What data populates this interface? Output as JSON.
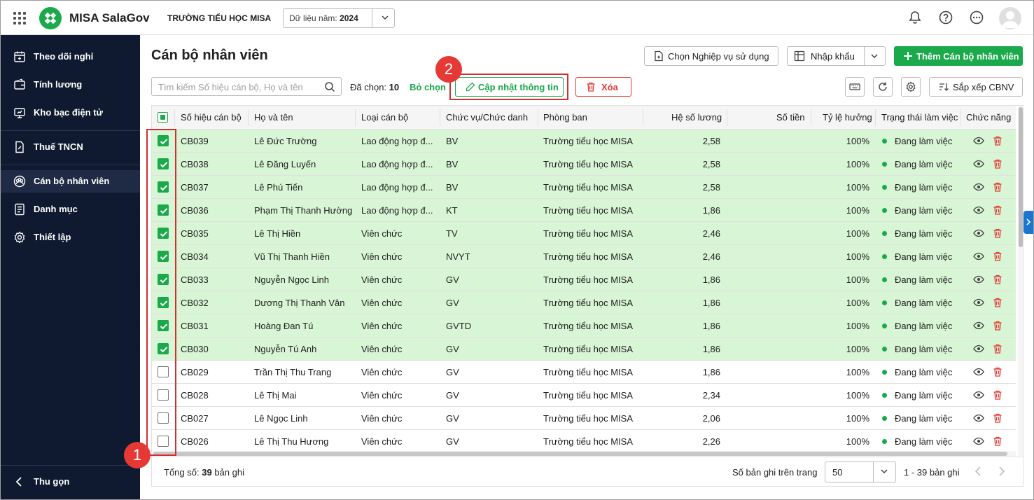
{
  "header": {
    "app_name": "MISA SalaGov",
    "school": "TRƯỜNG TIỂU HỌC MISA",
    "year_label": "Dữ liệu năm:",
    "year_value": "2024"
  },
  "sidebar": {
    "items": [
      {
        "label": "Theo dõi nghỉ",
        "icon": "calendar-icon"
      },
      {
        "label": "Tính lương",
        "icon": "wallet-icon"
      },
      {
        "label": "Kho bạc điện tử",
        "icon": "treasury-icon"
      },
      {
        "label": "Thuế TNCN",
        "icon": "tax-icon"
      },
      {
        "label": "Cán bộ nhân viên",
        "icon": "staff-icon"
      },
      {
        "label": "Danh mục",
        "icon": "catalog-icon"
      },
      {
        "label": "Thiết lập",
        "icon": "gear-icon"
      }
    ],
    "collapse_label": "Thu gọn"
  },
  "page": {
    "title": "Cán bộ nhân viên",
    "choose_service_label": "Chọn Nghiệp vụ sử dụng",
    "import_label": "Nhập khẩu",
    "add_label": "Thêm Cán bộ nhân viên",
    "search_placeholder": "Tìm kiếm Số hiệu cán bộ, Họ và tên",
    "selected_label": "Đã chọn:",
    "selected_count": "10",
    "deselect_label": "Bỏ chọn",
    "update_label": "Cập nhật thông tin",
    "delete_label": "Xóa",
    "sort_label": "Sắp xếp CBNV"
  },
  "annotations": {
    "badge1": "1",
    "badge2": "2"
  },
  "table": {
    "columns": [
      "Số hiệu cán bộ",
      "Họ và tên",
      "Loại cán bộ",
      "Chức vụ/Chức danh",
      "Phòng ban",
      "Hệ số lương",
      "Số tiền",
      "Tỷ lệ hưởng",
      "Trạng thái làm việc",
      "Chức năng"
    ],
    "rows": [
      {
        "selected": true,
        "code": "CB039",
        "name": "Lê Đức Trường",
        "type": "Lao động hợp đ...",
        "position": "BV",
        "dept": "Trường tiểu học MISA",
        "coef": "2,58",
        "amount": "",
        "rate": "100%",
        "status": "Đang làm việc"
      },
      {
        "selected": true,
        "code": "CB038",
        "name": "Lê Đăng Luyến",
        "type": "Lao động hợp đ...",
        "position": "BV",
        "dept": "Trường tiểu học MISA",
        "coef": "2,58",
        "amount": "",
        "rate": "100%",
        "status": "Đang làm việc"
      },
      {
        "selected": true,
        "code": "CB037",
        "name": "Lê Phú Tiến",
        "type": "Lao động hợp đ...",
        "position": "BV",
        "dept": "Trường tiểu học MISA",
        "coef": "2,58",
        "amount": "",
        "rate": "100%",
        "status": "Đang làm việc"
      },
      {
        "selected": true,
        "code": "CB036",
        "name": "Phạm Thị Thanh Hường",
        "type": "Lao động hợp đ...",
        "position": "KT",
        "dept": "Trường tiểu học MISA",
        "coef": "1,86",
        "amount": "",
        "rate": "100%",
        "status": "Đang làm việc"
      },
      {
        "selected": true,
        "code": "CB035",
        "name": "Lê Thị Hiền",
        "type": "Viên chức",
        "position": "TV",
        "dept": "Trường tiểu học MISA",
        "coef": "2,46",
        "amount": "",
        "rate": "100%",
        "status": "Đang làm việc"
      },
      {
        "selected": true,
        "code": "CB034",
        "name": "Vũ Thị Thanh Hiền",
        "type": "Viên chức",
        "position": "NVYT",
        "dept": "Trường tiểu học MISA",
        "coef": "2,46",
        "amount": "",
        "rate": "100%",
        "status": "Đang làm việc"
      },
      {
        "selected": true,
        "code": "CB033",
        "name": "Nguyễn Ngọc Linh",
        "type": "Viên chức",
        "position": "GV",
        "dept": "Trường tiểu học MISA",
        "coef": "1,86",
        "amount": "",
        "rate": "100%",
        "status": "Đang làm việc"
      },
      {
        "selected": true,
        "code": "CB032",
        "name": "Dương Thị Thanh Vân",
        "type": "Viên chức",
        "position": "GV",
        "dept": "Trường tiểu học MISA",
        "coef": "1,86",
        "amount": "",
        "rate": "100%",
        "status": "Đang làm việc"
      },
      {
        "selected": true,
        "code": "CB031",
        "name": "Hoàng Đan Tú",
        "type": "Viên chức",
        "position": "GVTD",
        "dept": "Trường tiểu học MISA",
        "coef": "1,86",
        "amount": "",
        "rate": "100%",
        "status": "Đang làm việc"
      },
      {
        "selected": true,
        "code": "CB030",
        "name": "Nguyễn Tú Anh",
        "type": "Viên chức",
        "position": "GV",
        "dept": "Trường tiểu học MISA",
        "coef": "1,86",
        "amount": "",
        "rate": "100%",
        "status": "Đang làm việc"
      },
      {
        "selected": false,
        "code": "CB029",
        "name": "Trần Thị Thu Trang",
        "type": "Viên chức",
        "position": "GV",
        "dept": "Trường tiểu học MISA",
        "coef": "1,86",
        "amount": "",
        "rate": "100%",
        "status": "Đang làm việc"
      },
      {
        "selected": false,
        "code": "CB028",
        "name": "Lê Thị Mai",
        "type": "Viên chức",
        "position": "GV",
        "dept": "Trường tiểu học MISA",
        "coef": "2,34",
        "amount": "",
        "rate": "100%",
        "status": "Đang làm việc"
      },
      {
        "selected": false,
        "code": "CB027",
        "name": "Lê Ngọc Linh",
        "type": "Viên chức",
        "position": "GV",
        "dept": "Trường tiểu học MISA",
        "coef": "2,06",
        "amount": "",
        "rate": "100%",
        "status": "Đang làm việc"
      },
      {
        "selected": false,
        "code": "CB026",
        "name": "Lê Thị Thu Hương",
        "type": "Viên chức",
        "position": "GV",
        "dept": "Trường tiểu học MISA",
        "coef": "2,26",
        "amount": "",
        "rate": "100%",
        "status": "Đang làm việc"
      }
    ]
  },
  "footer": {
    "total_label": "Tổng số:",
    "total_count": "39",
    "total_suffix": "bản ghi",
    "per_page_label": "Số bản ghi trên trang",
    "per_page_value": "50",
    "range": "1 - 39 bản ghi"
  },
  "colors": {
    "accent": "#1aa94b",
    "sidebar": "#0f1a30",
    "danger": "#e53935",
    "selected_row": "#d8f5d5"
  }
}
